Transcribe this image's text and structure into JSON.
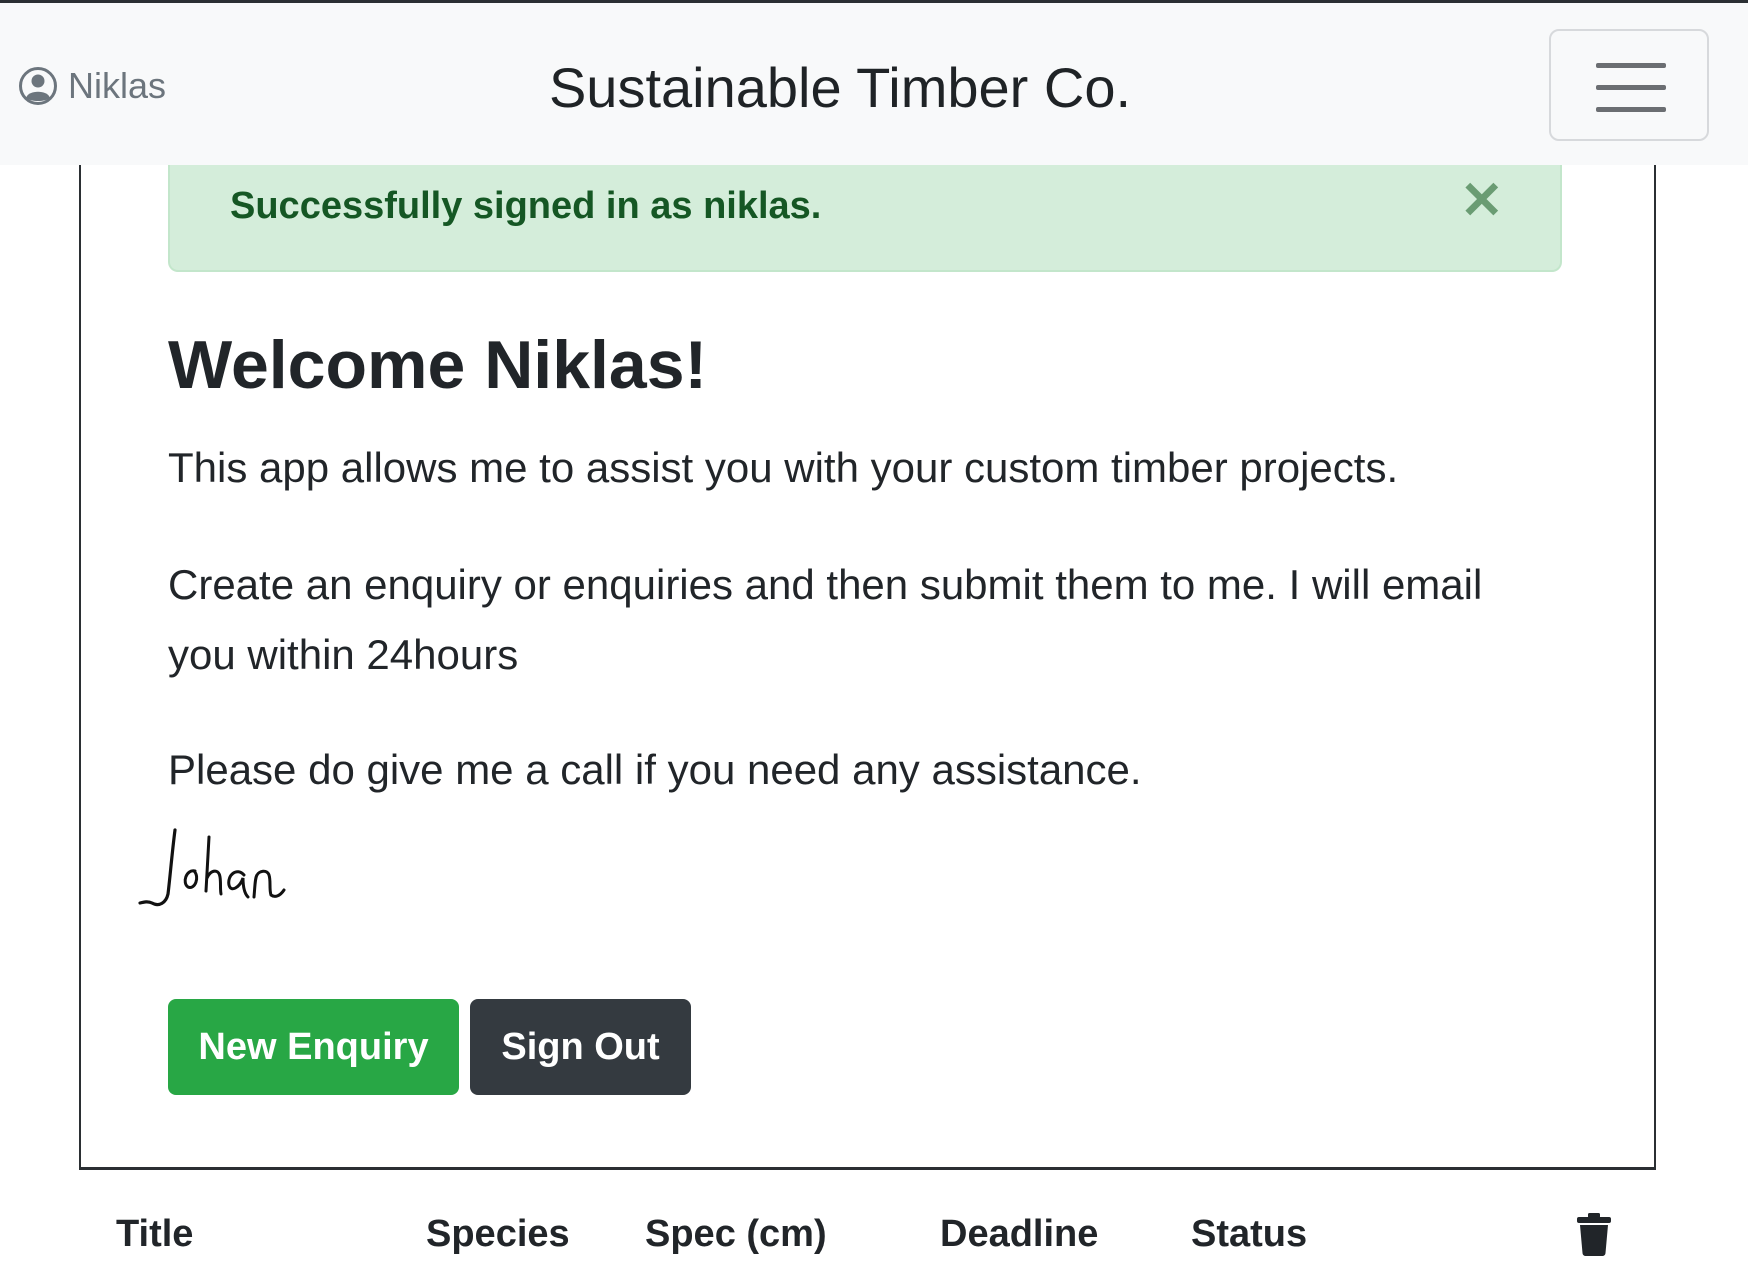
{
  "navbar": {
    "user_name": "Niklas",
    "brand": "Sustainable Timber Co."
  },
  "alert": {
    "message": "Successfully signed in as niklas.",
    "close_symbol": "✕"
  },
  "main": {
    "heading": "Welcome Niklas!",
    "paragraph_1": "This app allows me to assist you with your custom timber projects.",
    "paragraph_2": "Create an enquiry or enquiries and then submit them to me. I will email you within 24hours",
    "paragraph_3": "Please do give me a call if you need any assistance.",
    "signature": "Johan"
  },
  "buttons": {
    "new_enquiry": "New Enquiry",
    "sign_out": "Sign Out"
  },
  "table": {
    "headers": [
      "Title",
      "Species",
      "Spec (cm)",
      "Deadline",
      "Status"
    ],
    "delete_icon": "trash-icon"
  },
  "colors": {
    "primary_green": "#28a745",
    "dark": "#343a40",
    "alert_bg": "#d4edda",
    "alert_text": "#155724"
  }
}
